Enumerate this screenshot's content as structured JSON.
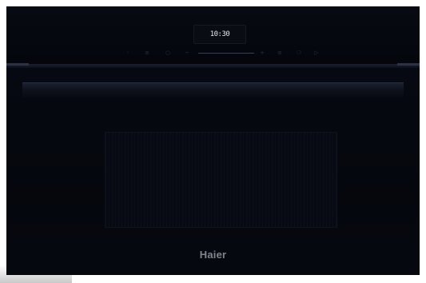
{
  "display": {
    "time": "10:30"
  },
  "controls": [
    {
      "icon": "power-icon",
      "glyph": "◦"
    },
    {
      "icon": "menu-icon",
      "glyph": "≡"
    },
    {
      "icon": "timer-icon",
      "glyph": "○"
    },
    {
      "icon": "minus-icon",
      "glyph": "−"
    },
    {
      "icon": "plus-icon",
      "glyph": "+"
    },
    {
      "icon": "light-icon",
      "glyph": "≡"
    },
    {
      "icon": "key-lock-icon",
      "glyph": "⚆"
    },
    {
      "icon": "start-icon",
      "glyph": "▷"
    }
  ],
  "brand": {
    "logo": "Haier"
  }
}
